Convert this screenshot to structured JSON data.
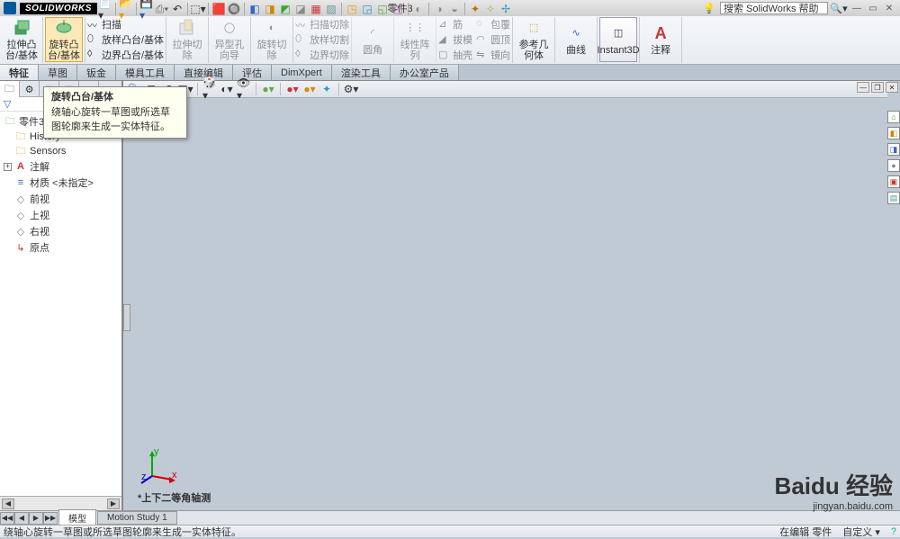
{
  "title": {
    "app": "SOLIDWORKS",
    "ds": "DS",
    "doc": "零件3"
  },
  "search": {
    "placeholder": "搜索 SolidWorks 帮助"
  },
  "qat": {
    "new": "□",
    "open": "📂",
    "save": "💾",
    "print": "🖨",
    "undo": "↶",
    "redo": "↷",
    "select": "▭",
    "rebuild": "🔄",
    "options": "⚙"
  },
  "ribbon": {
    "extrude": "拉伸凸台/基体",
    "revolve": "旋转凸台/基体",
    "sweep": "扫描",
    "loft": "放样凸台/基体",
    "boundary": "边界凸台/基体",
    "cut_extrude": "拉伸切除",
    "hole": "异型孔向导",
    "cut_revolve": "旋转切除",
    "cut_sweep": "扫描切除",
    "cut_loft": "放样切割",
    "cut_boundary": "边界切除",
    "fillet": "圆角",
    "pattern": "线性阵列",
    "rib": "筋",
    "draft": "拔模",
    "shell": "抽壳",
    "wrap": "包覆",
    "dome": "圆顶",
    "mirror": "镜向",
    "refgeo": "参考几何体",
    "curves": "曲线",
    "instant3d": "Instant3D",
    "annotate": "注释"
  },
  "tabs": {
    "t1": "特征",
    "t2": "草图",
    "t3": "钣金",
    "t4": "模具工具",
    "t5": "直接编辑",
    "t6": "评估",
    "t7": "DimXpert",
    "t8": "渲染工具",
    "t9": "办公室产品"
  },
  "tree": {
    "root": "零件3 (",
    "history": "History",
    "sensors": "Sensors",
    "annotations": "注解",
    "material": "材质 <未指定>",
    "front": "前视",
    "top": "上视",
    "right": "右视",
    "origin": "原点"
  },
  "tooltip": {
    "title": "旋转凸台/基体",
    "body": "绕轴心旋转一草图或所选草图轮廓来生成一实体特征。"
  },
  "view_label": "*上下二等角轴测",
  "bottom_tabs": {
    "model": "模型",
    "motion": "Motion Study 1"
  },
  "status": {
    "hint": "绕轴心旋转一草图或所选草图轮廓来生成一实体特征。",
    "editing": "在编辑 零件",
    "custom": "自定义 ▾"
  },
  "watermark": {
    "brand": "Baidu 经验",
    "url": "jingyan.baidu.com"
  },
  "triad": {
    "x": "x",
    "y": "y",
    "z": "z"
  }
}
